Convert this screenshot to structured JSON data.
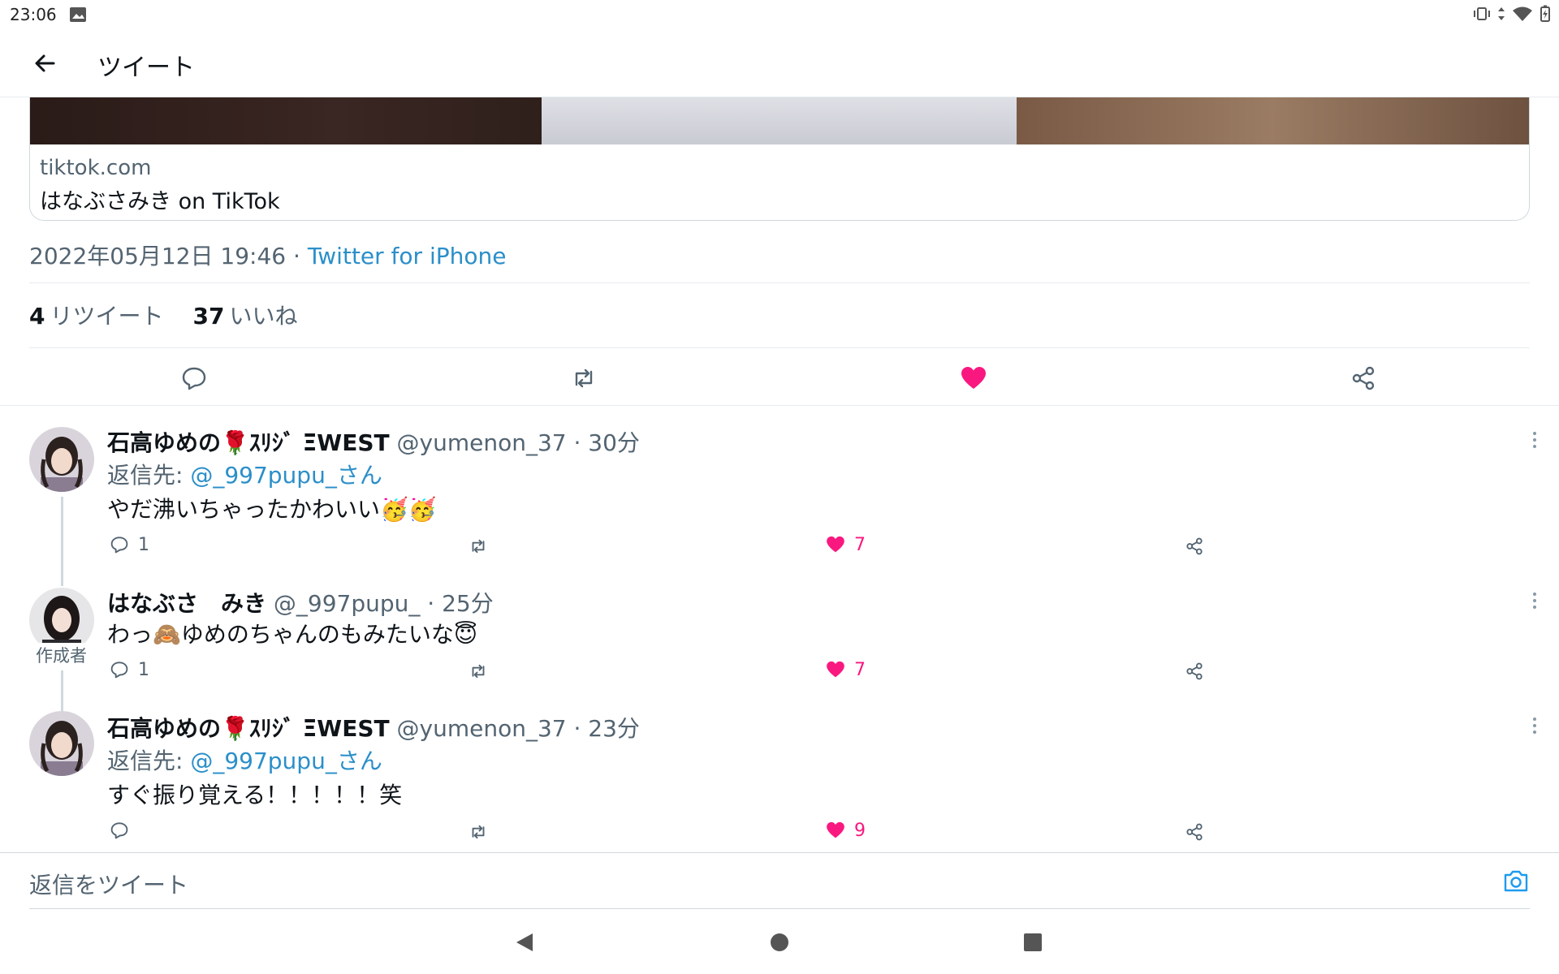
{
  "status_bar": {
    "time": "23:06"
  },
  "app_bar": {
    "title": "ツイート"
  },
  "link_card": {
    "domain": "tiktok.com",
    "title": "はなぶさみき on TikTok"
  },
  "tweet_meta": {
    "date": "2022年05月12日 19:46",
    "separator": " · ",
    "source": "Twitter for iPhone"
  },
  "stats": {
    "retweets_count": "4",
    "retweets_label": "リツイート",
    "likes_count": "37",
    "likes_label": "いいね"
  },
  "colors": {
    "like": "#f91880",
    "link": "#2b8fc9",
    "muted": "#536471"
  },
  "replies": [
    {
      "name": "石高ゆめの🌹ｽﾘｼﾞ ΞWEST",
      "handle_time": "@yumenon_37 · 30分",
      "reply_prefix": "返信先: ",
      "reply_to": "@_997pupu_さん",
      "text": "やだ沸いちゃったかわいい🥳🥳",
      "reply_count": "1",
      "retweet_count": "",
      "like_count": "7"
    },
    {
      "name": "はなぶさ　みき",
      "handle_time": "@_997pupu_ · 25分",
      "badge": "作成者",
      "text": "わっ🙈ゆめのちゃんのもみたいな😇",
      "reply_count": "1",
      "retweet_count": "",
      "like_count": "7"
    },
    {
      "name": "石高ゆめの🌹ｽﾘｼﾞ ΞWEST",
      "handle_time": "@yumenon_37 · 23分",
      "reply_prefix": "返信先: ",
      "reply_to": "@_997pupu_さん",
      "text": "すぐ振り覚える！！！！！笑",
      "reply_count": "",
      "retweet_count": "",
      "like_count": "9"
    }
  ],
  "compose": {
    "placeholder": "返信をツイート"
  },
  "icons": [
    "back-arrow-icon",
    "reply-icon",
    "retweet-icon",
    "heart-icon",
    "share-icon",
    "more-icon",
    "camera-icon"
  ]
}
